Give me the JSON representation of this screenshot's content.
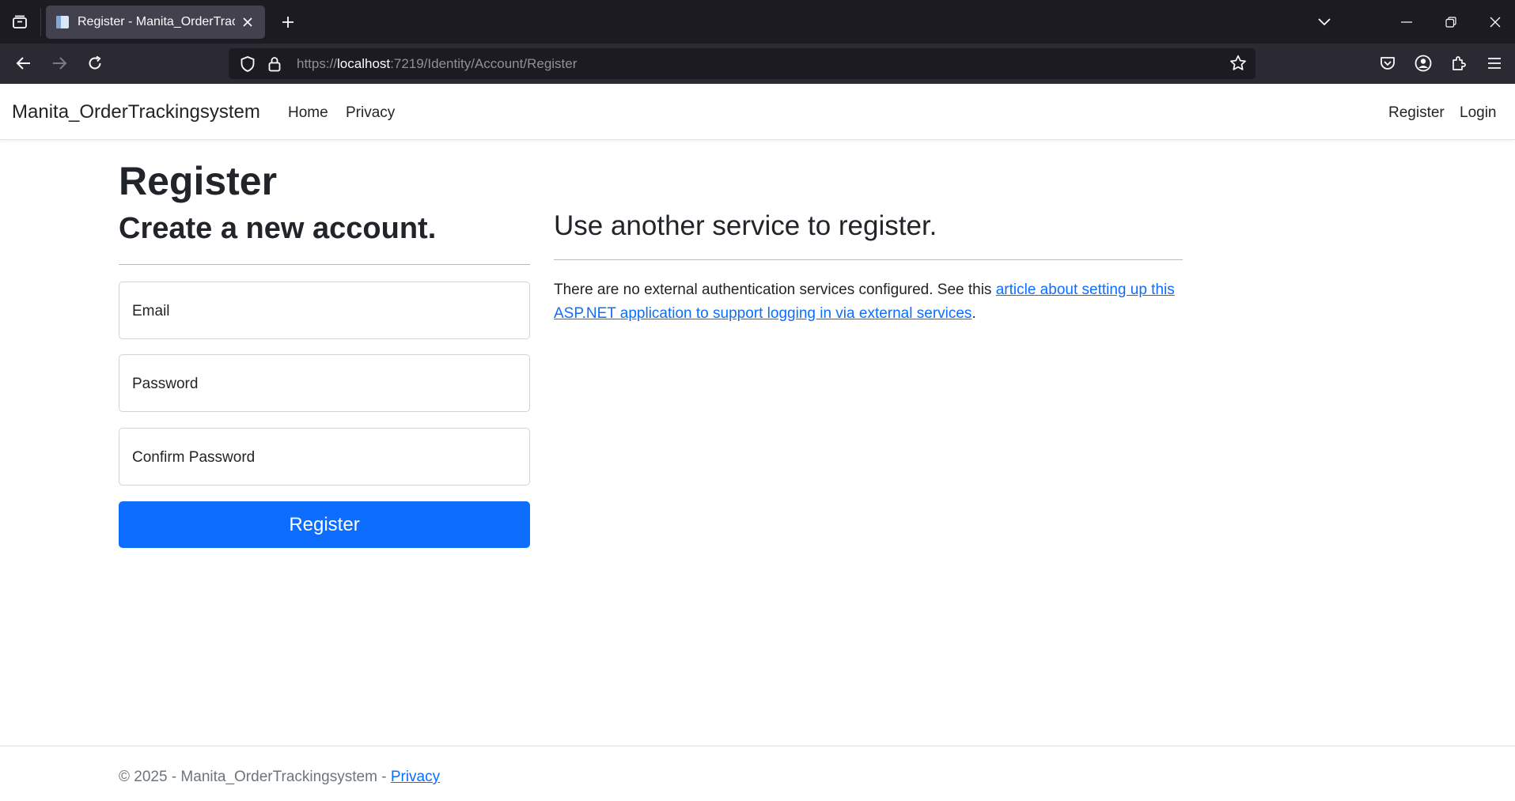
{
  "browser": {
    "tab_title": "Register - Manita_OrderTracking",
    "url_prefix": "https://",
    "url_host": "localhost",
    "url_rest": ":7219/Identity/Account/Register"
  },
  "site_nav": {
    "brand": "Manita_OrderTrackingsystem",
    "links": [
      "Home",
      "Privacy"
    ],
    "right_links": [
      "Register",
      "Login"
    ]
  },
  "page": {
    "title": "Register",
    "subtitle": "Create a new account.",
    "fields": {
      "email_label": "Email",
      "password_label": "Password",
      "confirm_label": "Confirm Password"
    },
    "register_button": "Register",
    "external": {
      "heading": "Use another service to register.",
      "text_before": "There are no external authentication services configured. See this ",
      "link_text": "article about setting up this ASP.NET application to support logging in via external services",
      "text_after": "."
    }
  },
  "footer": {
    "text": "© 2025 - Manita_OrderTrackingsystem - ",
    "privacy_link": "Privacy"
  },
  "colors": {
    "primary": "#0d6efd",
    "browser_dark": "#1c1b22"
  }
}
